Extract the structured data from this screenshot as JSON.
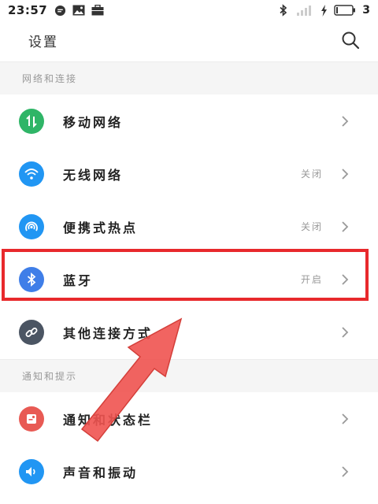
{
  "status_bar": {
    "time": "23:57",
    "battery_level": "3",
    "icons_left": [
      "chat-bubble-icon",
      "image-message-icon",
      "briefcase-icon"
    ],
    "icons_right": [
      "bluetooth-icon",
      "signal-icon",
      "charging-icon",
      "battery-icon"
    ]
  },
  "header": {
    "title": "设置",
    "search_icon": "search-icon"
  },
  "sections": [
    {
      "title": "网络和连接",
      "items": [
        {
          "label": "移动网络",
          "value": "",
          "icon": "mobile-data-icon",
          "color": "#2fb567"
        },
        {
          "label": "无线网络",
          "value": "关闭",
          "icon": "wifi-icon",
          "color": "#2196f3"
        },
        {
          "label": "便携式热点",
          "value": "关闭",
          "icon": "hotspot-icon",
          "color": "#2196f3"
        },
        {
          "label": "蓝牙",
          "value": "开启",
          "icon": "bluetooth-icon",
          "color": "#3f7ee8"
        },
        {
          "label": "其他连接方式",
          "value": "",
          "icon": "link-icon",
          "color": "#4b5563"
        }
      ]
    },
    {
      "title": "通知和提示",
      "items": [
        {
          "label": "通知和状态栏",
          "value": "",
          "icon": "notification-icon",
          "color": "#e85a54"
        },
        {
          "label": "声音和振动",
          "value": "",
          "icon": "sound-icon",
          "color": "#2196f3"
        }
      ]
    }
  ],
  "colors": {
    "highlight": "#e8292c",
    "arrow": "#ef5350",
    "section_bg": "#f5f5f5"
  }
}
